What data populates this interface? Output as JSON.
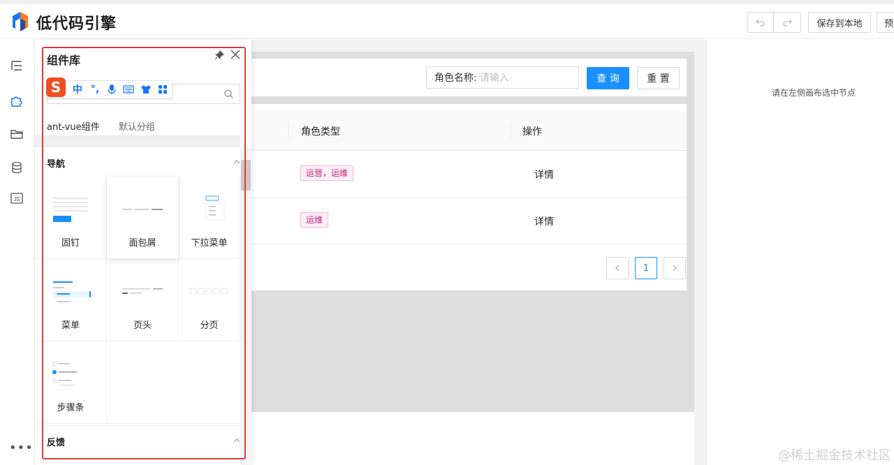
{
  "header": {
    "app_title": "低代码引擎",
    "save_label": "保存到本地",
    "preview_label": "预"
  },
  "rail": {
    "items": [
      "outline-icon",
      "component-icon",
      "folder-icon",
      "datasource-icon",
      "js-icon"
    ],
    "js_label": "JS",
    "more": "•••"
  },
  "library": {
    "title": "组件库",
    "ime": {
      "s": "S",
      "zh": "中",
      "punct": "°,"
    },
    "tabs": [
      {
        "label": "ant-vue组件"
      },
      {
        "label": "默认分组"
      }
    ],
    "sections": [
      {
        "title": "导航"
      },
      {
        "title": "反馈"
      }
    ],
    "components": [
      {
        "label": "固钉"
      },
      {
        "label": "面包屑"
      },
      {
        "label": "下拉菜单"
      },
      {
        "label": "菜单"
      },
      {
        "label": "页头"
      },
      {
        "label": "分页"
      },
      {
        "label": "步骤条"
      }
    ]
  },
  "canvas": {
    "search": {
      "label": "角色名称:",
      "placeholder": "请输入",
      "query_label": "查 询",
      "reset_label": "重 置"
    },
    "table": {
      "columns": [
        "角色类型",
        "操作"
      ],
      "rows": [
        {
          "tag": "运营，运维",
          "action": "详情"
        },
        {
          "tag": "运维",
          "action": "详情"
        }
      ]
    },
    "pagination": {
      "current": "1"
    }
  },
  "right_panel": {
    "hint": "请在左侧画布选中节点"
  },
  "watermark": "@稀土掘金技术社区",
  "colors": {
    "primary": "#1890ff",
    "tag_text": "#c41d7f",
    "tag_border": "#ffadd2",
    "highlight_outline": "#e53935"
  }
}
